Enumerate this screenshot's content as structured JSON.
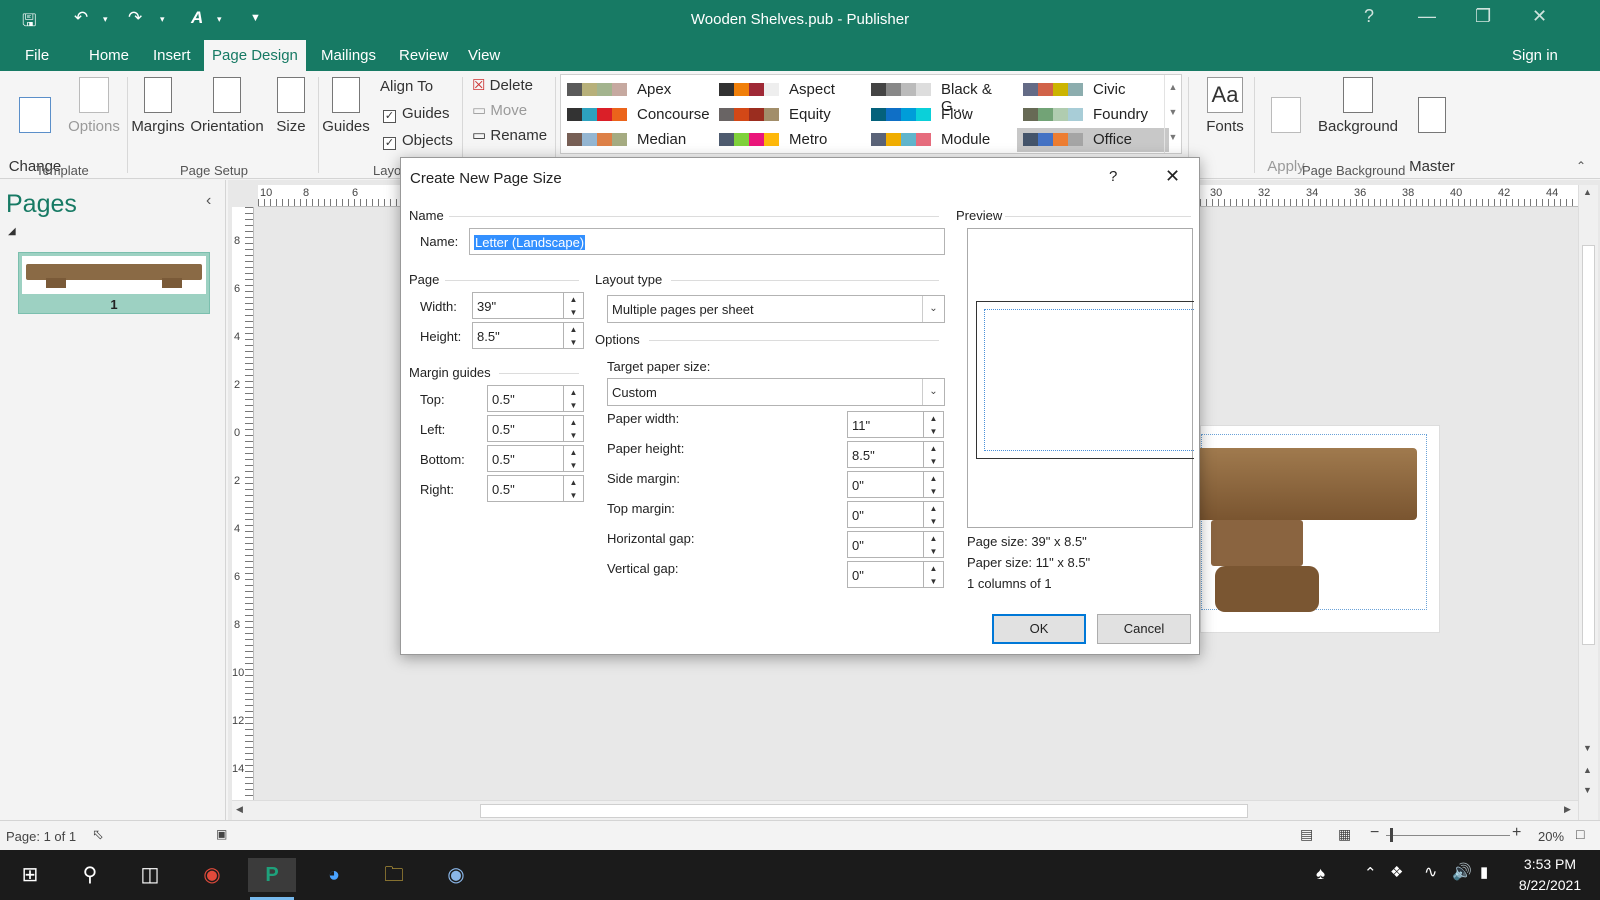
{
  "app": {
    "title": "Wooden Shelves.pub - Publisher",
    "sign_in": "Sign in"
  },
  "tabs": [
    "File",
    "Home",
    "Insert",
    "Page Design",
    "Mailings",
    "Review",
    "View"
  ],
  "ribbon": {
    "change_template": "Change\nTemplate",
    "options": "Options",
    "template_group": "Template",
    "margins": "Margins",
    "orientation": "Orientation",
    "size": "Size",
    "page_setup_group": "Page Setup",
    "guides": "Guides",
    "align_to": "Align To",
    "align_guides": "Guides",
    "align_objects": "Objects",
    "layout_group": "Layo",
    "delete": "Delete",
    "move": "Move",
    "rename": "Rename",
    "fonts": "Fonts",
    "apply_image": "Apply\nImage",
    "background": "Background",
    "master_pages": "Master\nPages",
    "page_background_group": "Page Background",
    "themes": [
      {
        "name": "Apex",
        "colors": [
          "#5a5a5a",
          "#b7b07a",
          "#a3b48e",
          "#c6a9a0"
        ]
      },
      {
        "name": "Aspect",
        "colors": [
          "#323232",
          "#f07f09",
          "#9f2936",
          "#eeeeee"
        ]
      },
      {
        "name": "Black & G...",
        "colors": [
          "#444444",
          "#888888",
          "#bbbbbb",
          "#dddddd"
        ]
      },
      {
        "name": "Civic",
        "colors": [
          "#646b86",
          "#d16349",
          "#ccb400",
          "#8cadae"
        ]
      },
      {
        "name": "Concourse",
        "colors": [
          "#333333",
          "#2da2bf",
          "#da1f28",
          "#eb641b"
        ]
      },
      {
        "name": "Equity",
        "colors": [
          "#696464",
          "#d34817",
          "#9b2d1f",
          "#a28e6a"
        ]
      },
      {
        "name": "Flow",
        "colors": [
          "#04617b",
          "#0f6fc6",
          "#009dd9",
          "#0bd0d9"
        ]
      },
      {
        "name": "Foundry",
        "colors": [
          "#676a55",
          "#72a376",
          "#b0ccb0",
          "#a8cdd7"
        ]
      },
      {
        "name": "Median",
        "colors": [
          "#775f55",
          "#94b6d2",
          "#dd8047",
          "#a5ab81"
        ]
      },
      {
        "name": "Metro",
        "colors": [
          "#4e5b6f",
          "#7fd13b",
          "#ea157a",
          "#feb80a"
        ]
      },
      {
        "name": "Module",
        "colors": [
          "#5a6378",
          "#f0ad00",
          "#60b5cc",
          "#e66c7d"
        ]
      },
      {
        "name": "Office",
        "colors": [
          "#44546a",
          "#4472c4",
          "#ed7d31",
          "#a5a5a5"
        ]
      }
    ]
  },
  "pages_pane": {
    "title": "Pages",
    "page_number": "1"
  },
  "rulers": {
    "h_left": [
      "10",
      "8",
      "6"
    ],
    "h_right": [
      "30",
      "32",
      "34",
      "36",
      "38",
      "40",
      "42",
      "44"
    ],
    "v": [
      "8",
      "6",
      "4",
      "2",
      "0",
      "2",
      "4",
      "6",
      "8",
      "10",
      "12",
      "14"
    ]
  },
  "dialog": {
    "title": "Create New Page Size",
    "help": "?",
    "name_section": "Name",
    "name_label": "Name:",
    "name_value": "Letter (Landscape)",
    "page_section": "Page",
    "width_label": "Width:",
    "width_value": "39\"",
    "height_label": "Height:",
    "height_value": "8.5\"",
    "margin_section": "Margin guides",
    "top_label": "Top:",
    "top_value": "0.5\"",
    "left_label": "Left:",
    "left_value": "0.5\"",
    "bottom_label": "Bottom:",
    "bottom_value": "0.5\"",
    "right_label": "Right:",
    "right_value": "0.5\"",
    "layout_section": "Layout type",
    "layout_value": "Multiple pages per sheet",
    "options_section": "Options",
    "target_label": "Target paper size:",
    "target_value": "Custom",
    "paper_width_label": "Paper width:",
    "paper_width_value": "11\"",
    "paper_height_label": "Paper height:",
    "paper_height_value": "8.5\"",
    "side_margin_label": "Side margin:",
    "side_margin_value": "0\"",
    "top_margin_label": "Top margin:",
    "top_margin_value": "0\"",
    "h_gap_label": "Horizontal gap:",
    "h_gap_value": "0\"",
    "v_gap_label": "Vertical gap:",
    "v_gap_value": "0\"",
    "preview_section": "Preview",
    "page_size_text": "Page size: 39\" x 8.5\"",
    "paper_size_text": "Paper size: 11\" x 8.5\"",
    "columns_text": "1 columns of 1",
    "ok": "OK",
    "cancel": "Cancel"
  },
  "status": {
    "page": "Page: 1 of 1",
    "zoom": "20%"
  },
  "taskbar": {
    "time": "3:53 PM",
    "date": "8/22/2021"
  }
}
